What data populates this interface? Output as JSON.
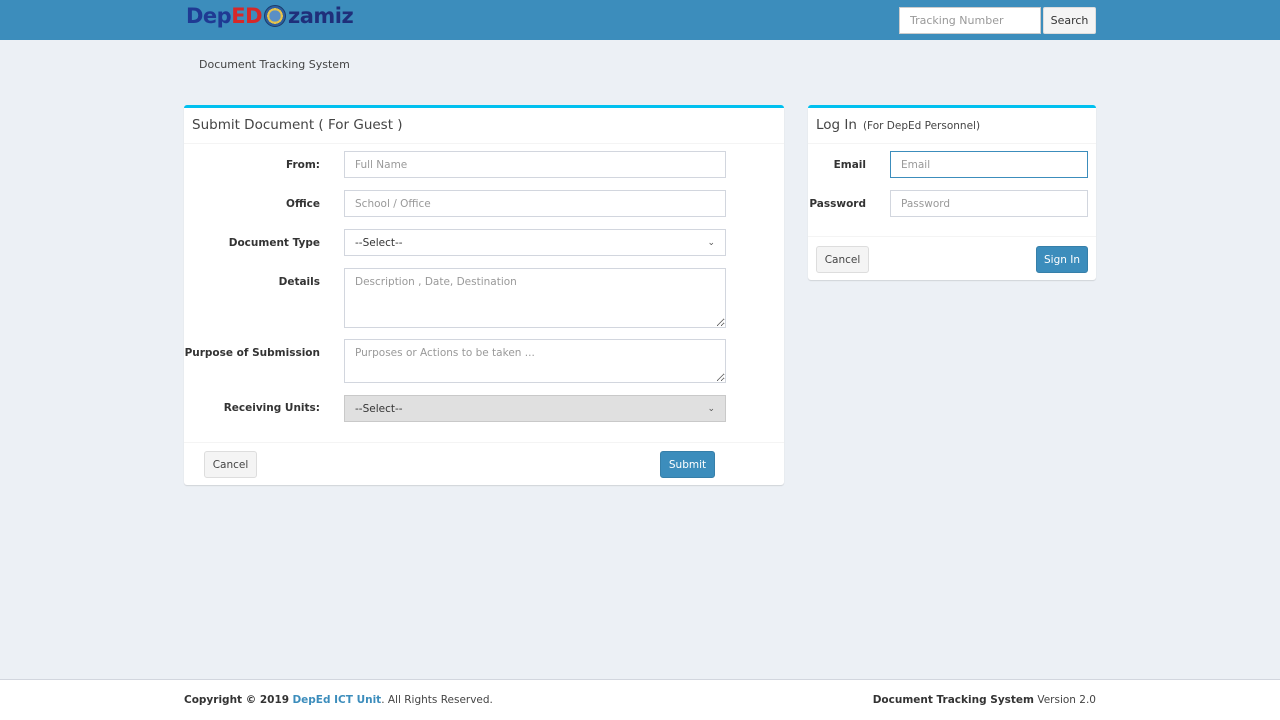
{
  "header": {
    "logo": {
      "part1": "Dep",
      "part2": "ED",
      "part3": "zamiz"
    },
    "tracking_placeholder": "Tracking Number",
    "search_label": "Search"
  },
  "breadcrumb": "Document Tracking System",
  "guest_form": {
    "title": "Submit Document ( For Guest )",
    "from_label": "From:",
    "from_placeholder": "Full Name",
    "office_label": "Office",
    "office_placeholder": "School / Office",
    "doctype_label": "Document Type",
    "doctype_value": "--Select--",
    "details_label": "Details",
    "details_placeholder": "Description , Date, Destination",
    "purpose_label": "Purpose of Submission",
    "purpose_placeholder": "Purposes or Actions to be taken ...",
    "units_label": "Receiving Units:",
    "units_value": "--Select--",
    "cancel_label": "Cancel",
    "submit_label": "Submit"
  },
  "login": {
    "title": "Log In",
    "subtitle": "(For DepEd Personnel)",
    "email_label": "Email",
    "email_placeholder": "Email",
    "password_label": "Password",
    "password_placeholder": "Password",
    "cancel_label": "Cancel",
    "signin_label": "Sign In"
  },
  "footer": {
    "copyright_prefix": "Copyright © 2019",
    "org": "DepEd ICT Unit",
    "rights": ". All Rights Reserved.",
    "system_name": "Document Tracking System",
    "version": "Version 2.0"
  },
  "colors": {
    "primary": "#3c8dbc",
    "box_accent": "#00c0ef",
    "background": "#ecf0f5"
  }
}
